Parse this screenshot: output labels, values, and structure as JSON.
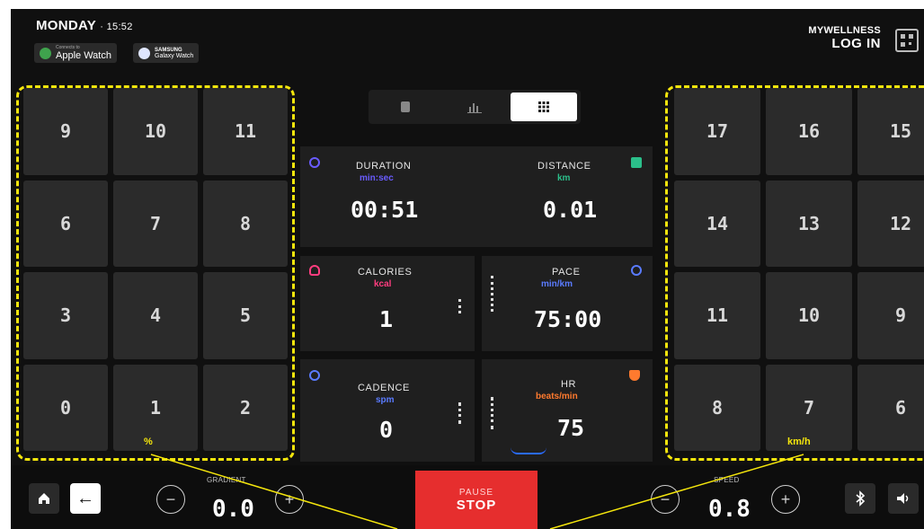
{
  "header": {
    "day": "MONDAY",
    "time": "· 15:52",
    "badges": [
      {
        "small": "Connects to",
        "label": "Apple Watch",
        "icon": "apple-watch-icon"
      },
      {
        "small": "SAMSUNG",
        "label": "Galaxy Watch",
        "icon": "galaxy-watch-icon"
      }
    ],
    "brand_top": "MYWELLNESS",
    "brand_bottom": "LOG IN"
  },
  "gradient_keypad": {
    "keys": [
      "9",
      "10",
      "11",
      "6",
      "7",
      "8",
      "3",
      "4",
      "5",
      "0",
      "1",
      "2"
    ],
    "unit": "%"
  },
  "speed_keypad": {
    "keys": [
      "17",
      "16",
      "15",
      "14",
      "13",
      "12",
      "11",
      "10",
      "9",
      "8",
      "7",
      "6"
    ],
    "unit": "km/h"
  },
  "view_selector": {
    "options": [
      "single-view-icon",
      "chart-view-icon",
      "grid-view-icon"
    ],
    "selected": 2
  },
  "metrics": {
    "duration": {
      "label": "DURATION",
      "unit": "min:sec",
      "value": "00:51",
      "color": "#6a5cff"
    },
    "distance": {
      "label": "DISTANCE",
      "unit": "km",
      "value": "0.01",
      "color": "#2bbf8a"
    },
    "calories": {
      "label": "CALORIES",
      "unit": "kcal",
      "value": "1",
      "color": "#ff3d7f"
    },
    "pace": {
      "label": "PACE",
      "unit": "min/km",
      "value": "75:00",
      "color": "#5a7bff"
    },
    "cadence": {
      "label": "CADENCE",
      "unit": "spm",
      "value": "0",
      "color": "#5a7bff"
    },
    "hr": {
      "label": "HR",
      "unit": "beats/min",
      "value": "75",
      "color": "#ff7a2e"
    }
  },
  "controls": {
    "gradient_caption": "GRADIENT",
    "gradient_value": "0.0",
    "speed_caption": "SPEED",
    "speed_value": "0.8",
    "pause_label": "PAUSE",
    "stop_label": "STOP",
    "minus": "−",
    "plus": "+",
    "back_arrow": "←"
  },
  "colors": {
    "accent_yellow": "#f5e60c",
    "stop_red": "#e62e2e"
  }
}
